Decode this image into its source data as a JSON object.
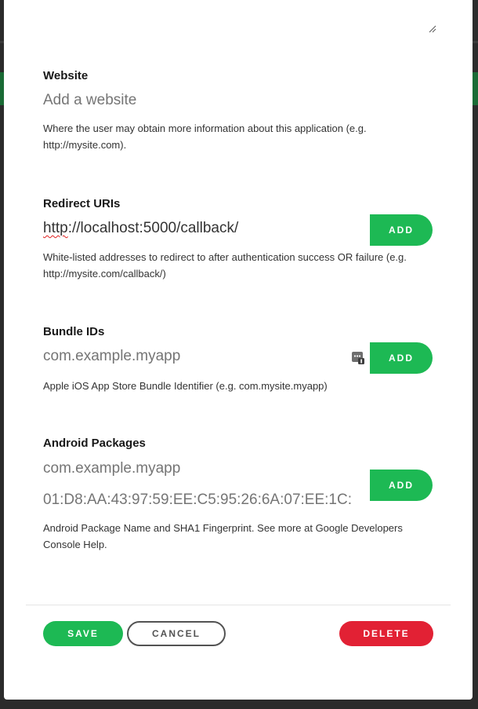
{
  "website": {
    "label": "Website",
    "placeholder": "Add a website",
    "help": "Where the user may obtain more information about this application (e.g. http://mysite.com)."
  },
  "redirect": {
    "label": "Redirect URIs",
    "value_scheme": "http",
    "value_rest": "://localhost:5000/callback/",
    "add_label": "ADD",
    "help": "White-listed addresses to redirect to after authentication success OR failure (e.g. http://mysite.com/callback/)"
  },
  "bundle": {
    "label": "Bundle IDs",
    "placeholder": "com.example.myapp",
    "add_label": "ADD",
    "help": "Apple iOS App Store Bundle Identifier (e.g. com.mysite.myapp)"
  },
  "android": {
    "label": "Android Packages",
    "package_placeholder": "com.example.myapp",
    "fingerprint_placeholder": "01:D8:AA:43:97:59:EE:C5:95:26:6A:07:EE:1C:",
    "add_label": "ADD",
    "help": "Android Package Name and SHA1 Fingerprint. See more at Google Developers Console Help."
  },
  "footer": {
    "save_label": "SAVE",
    "cancel_label": "CANCEL",
    "delete_label": "DELETE"
  },
  "colors": {
    "accent": "#1db954",
    "danger": "#e22134",
    "text": "#181818",
    "placeholder": "#b3b3b3"
  },
  "icons": [
    "resize-grip-icon",
    "password-manager-icon"
  ]
}
